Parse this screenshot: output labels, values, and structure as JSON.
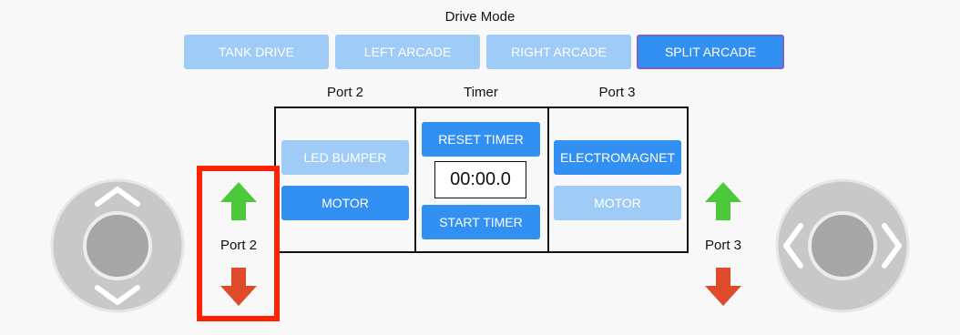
{
  "drive_mode": {
    "title": "Drive Mode",
    "modes": [
      "TANK DRIVE",
      "LEFT ARCADE",
      "RIGHT ARCADE",
      "SPLIT ARCADE"
    ],
    "selected": "SPLIT ARCADE"
  },
  "panels": {
    "port2": {
      "header": "Port 2",
      "led_bumper": "LED BUMPER",
      "motor": "MOTOR"
    },
    "timer": {
      "header": "Timer",
      "reset": "RESET TIMER",
      "display": "00:00.0",
      "start": "START TIMER"
    },
    "port3": {
      "header": "Port 3",
      "electromagnet": "ELECTROMAGNET",
      "motor": "MOTOR"
    }
  },
  "side_controls": {
    "left_label": "Port 2",
    "right_label": "Port 3"
  },
  "colors": {
    "active": "#3390f3",
    "inactive": "#9fcbf7",
    "up_arrow": "#4cc93a",
    "down_arrow": "#df4a2b",
    "highlight": "#ff2200"
  },
  "icons": [
    "up-arrow-icon",
    "down-arrow-icon",
    "chevron-up-icon",
    "chevron-down-icon",
    "chevron-left-icon",
    "chevron-right-icon"
  ]
}
